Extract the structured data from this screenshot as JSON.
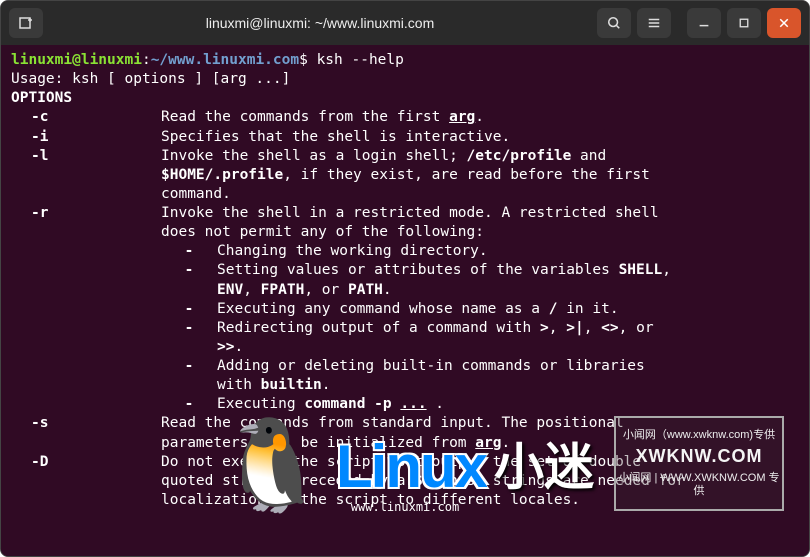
{
  "title": "linuxmi@linuxmi: ~/www.linuxmi.com",
  "prompt": {
    "user": "linuxmi@linuxmi",
    "sep": ":",
    "path": "~/www.linuxmi.com",
    "dollar": "$"
  },
  "command": "ksh --help",
  "usage": "Usage: ksh [ options ] [arg ...]",
  "options_header": "OPTIONS",
  "opts": {
    "c": {
      "flag": "-c",
      "desc": "Read the commands from the first ",
      "arg": "arg",
      "tail": "."
    },
    "i": {
      "flag": "-i",
      "desc": "Specifies that the shell is interactive."
    },
    "l": {
      "flag": "-l",
      "l1a": "Invoke the shell as a login shell; ",
      "l1b": "/etc/profile",
      "l1c": " and",
      "l2a": "$HOME/.profile",
      "l2b": ", if they exist, are read before the first",
      "l3": "command."
    },
    "r": {
      "flag": "-r",
      "l1": "Invoke the shell in a restricted mode. A restricted shell",
      "l2": "does not permit any of the following:",
      "s1": "Changing the working directory.",
      "s2a": "Setting values or attributes of the variables ",
      "s2b": "SHELL",
      "s2c": ",",
      "s3a": "ENV",
      "s3b": ", ",
      "s3c": "FPATH",
      "s3d": ", or ",
      "s3e": "PATH",
      "s3f": ".",
      "s4a": "Executing any command whose name as a ",
      "s4b": "/",
      "s4c": " in it.",
      "s5a": "Redirecting output of a command with ",
      "s5b": ">",
      "s5c": ", ",
      "s5d": ">|",
      "s5e": ", ",
      "s5f": "<>",
      "s5g": ", or",
      "s6a": ">>",
      "s6b": ".",
      "s7a": "Adding or deleting built-in commands or libraries",
      "s8a": "with ",
      "s8b": "builtin",
      "s8c": ".",
      "s9a": "Executing ",
      "s9b": "command -p",
      "s9c": " ",
      "s9d": "...",
      "s9e": " ."
    },
    "s": {
      "flag": "-s",
      "l1": "Read the commands from standard input. The positional",
      "l2a": "parameters will be initialized from ",
      "l2b": "arg",
      "l2c": "."
    },
    "D": {
      "flag": "-D",
      "l1": "Do not execute the script, but output the set of double",
      "l2a": "quoted strings preceded by a ",
      "l2b": "$",
      "l2c": ". These strings are needed for",
      "l3": "localization of the script to different locales."
    }
  },
  "watermark": {
    "brand": "Linux",
    "chars": "迷",
    "sub": "www.linuxmi.com"
  },
  "cornerbox": {
    "l1": "小闻网（www.xwknw.com)专供",
    "l2": "XWKNW.COM",
    "l3": "小闻网 | WWW.XWKNW.COM 专供"
  }
}
